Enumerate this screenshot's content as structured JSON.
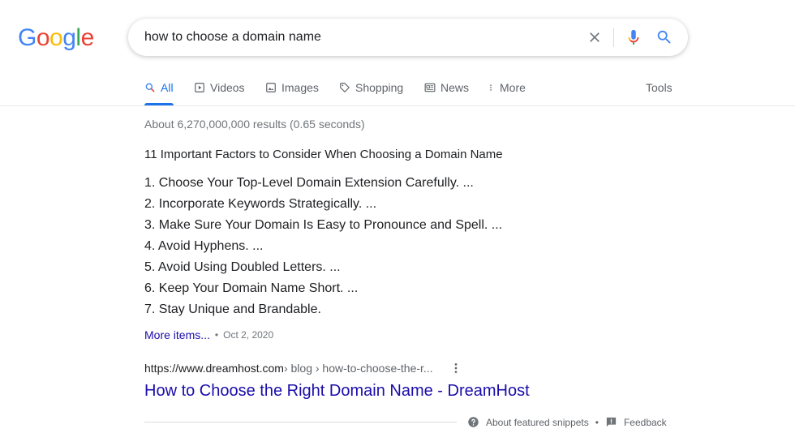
{
  "logo": {
    "letters": [
      "G",
      "o",
      "o",
      "g",
      "l",
      "e"
    ],
    "colors": [
      "#4285F4",
      "#EA4335",
      "#FBBC05",
      "#4285F4",
      "#34A853",
      "#EA4335"
    ]
  },
  "search": {
    "query": "how to choose a domain name"
  },
  "tabs": [
    {
      "label": "All",
      "icon": "search-icon",
      "active": true
    },
    {
      "label": "Videos",
      "icon": "play-icon"
    },
    {
      "label": "Images",
      "icon": "image-icon"
    },
    {
      "label": "Shopping",
      "icon": "tag-icon"
    },
    {
      "label": "News",
      "icon": "news-icon"
    },
    {
      "label": "More",
      "icon": "more-vert-icon"
    }
  ],
  "tools_label": "Tools",
  "stats": "About 6,270,000,000 results (0.65 seconds)",
  "snippet": {
    "title": "11 Important Factors to Consider When Choosing a Domain Name",
    "items": [
      "1. Choose Your Top-Level Domain Extension Carefully. ...",
      "2. Incorporate Keywords Strategically. ...",
      "3. Make Sure Your Domain Is Easy to Pronounce and Spell. ...",
      "4. Avoid Hyphens. ...",
      "5. Avoid Using Doubled Letters. ...",
      "6. Keep Your Domain Name Short. ...",
      "7. Stay Unique and Brandable."
    ],
    "more_items": "More items...",
    "dot": "•",
    "date": "Oct 2, 2020"
  },
  "result": {
    "cite_domain": "https://www.dreamhost.com",
    "cite_path": " › blog › how-to-choose-the-r...",
    "title": "How to Choose the Right Domain Name - DreamHost"
  },
  "footer": {
    "about": "About featured snippets",
    "dot": "•",
    "feedback": "Feedback"
  }
}
